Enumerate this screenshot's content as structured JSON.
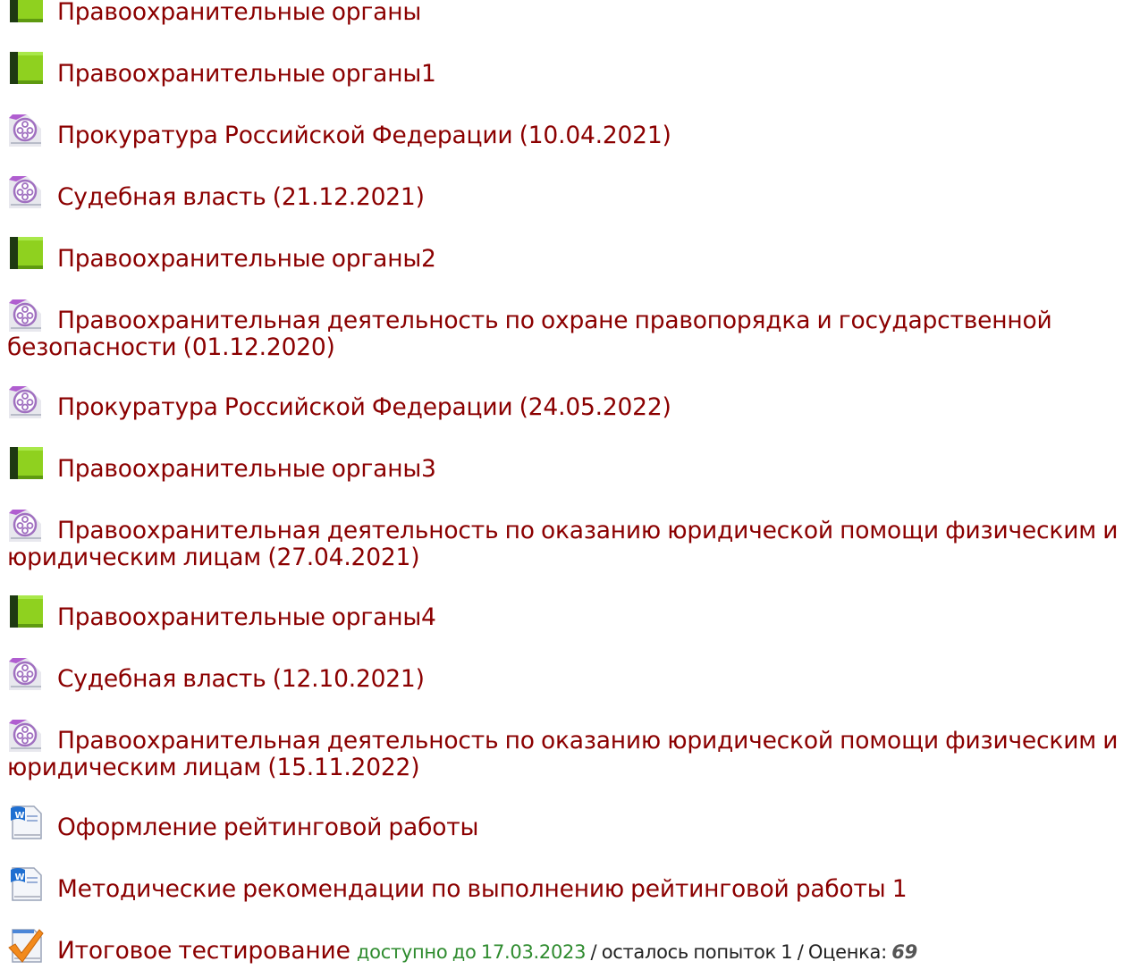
{
  "items": [
    {
      "icon": "book-icon",
      "title": "Правоохранительные органы"
    },
    {
      "icon": "book-icon",
      "title": "Правоохранительные органы1"
    },
    {
      "icon": "video-icon",
      "title": "Прокуратура Российской Федерации (10.04.2021)"
    },
    {
      "icon": "video-icon",
      "title": "Судебная власть (21.12.2021)"
    },
    {
      "icon": "book-icon",
      "title": "Правоохранительные органы2"
    },
    {
      "icon": "video-icon",
      "title": "Правоохранительная деятельность по охране правопорядка и государственной безопасности (01.12.2020)"
    },
    {
      "icon": "video-icon",
      "title": "Прокуратура Российской Федерации (24.05.2022)"
    },
    {
      "icon": "book-icon",
      "title": "Правоохранительные органы3"
    },
    {
      "icon": "video-icon",
      "title": "Правоохранительная деятельность по оказанию юридической помощи физическим и юридическим лицам (27.04.2021)"
    },
    {
      "icon": "book-icon",
      "title": "Правоохранительные органы4"
    },
    {
      "icon": "video-icon",
      "title": "Судебная власть (12.10.2021)"
    },
    {
      "icon": "video-icon",
      "title": "Правоохранительная деятельность по оказанию юридической помощи физическим и юридическим лицам (15.11.2022)"
    },
    {
      "icon": "word-doc-icon",
      "title": "Оформление рейтинговой работы"
    },
    {
      "icon": "word-doc-icon",
      "title": "Методические рекомендации по выполнению рейтинговой работы 1"
    },
    {
      "icon": "quiz-checkmark-icon",
      "title": "Итоговое тестирование"
    }
  ],
  "final_test": {
    "available": "доступно до 17.03.2023",
    "attempts": " / осталось попыток 1 / Оценка: ",
    "grade": "69"
  },
  "colors": {
    "link": "#8b0000",
    "available": "#2e8b2e",
    "text": "#222222"
  }
}
